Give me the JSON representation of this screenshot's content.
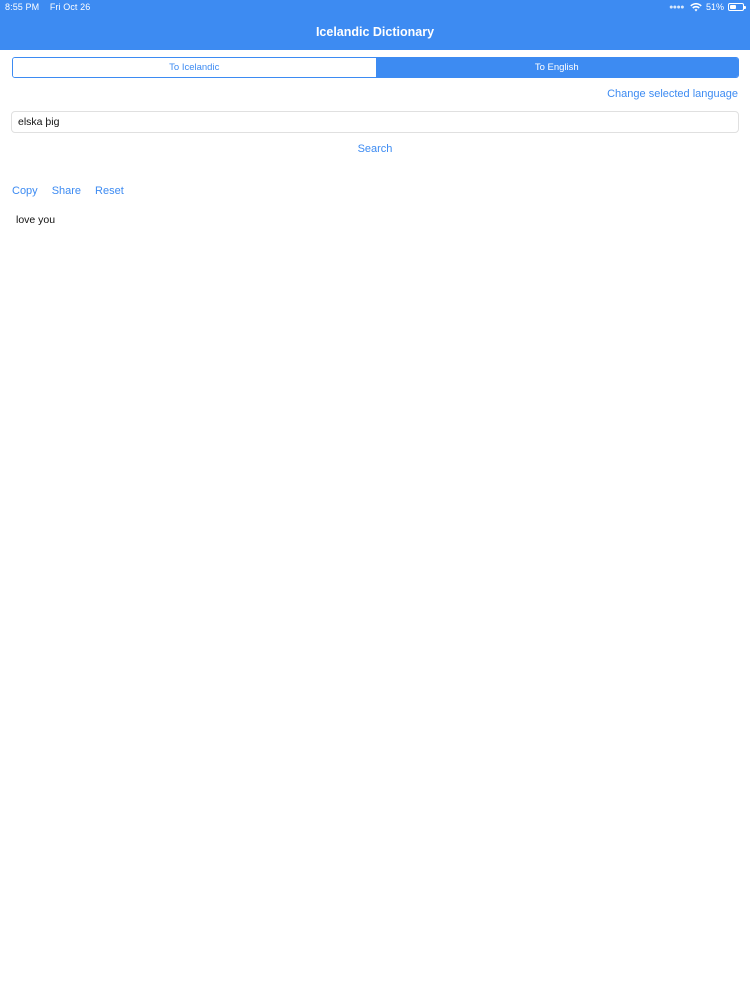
{
  "status_bar": {
    "time": "8:55 PM",
    "date": "Fri Oct 26",
    "battery": "51%",
    "battery_level": 0.51
  },
  "nav": {
    "title": "Icelandic Dictionary"
  },
  "segments": [
    {
      "label": "To Icelandic",
      "selected": false
    },
    {
      "label": "To English",
      "selected": true
    }
  ],
  "change_language_label": "Change selected language",
  "search": {
    "value": "elska þig",
    "button_label": "Search"
  },
  "actions": {
    "copy": "Copy",
    "share": "Share",
    "reset": "Reset"
  },
  "result": {
    "text": "love you"
  },
  "colors": {
    "accent": "#3d8bf2",
    "background": "#ffffff"
  }
}
